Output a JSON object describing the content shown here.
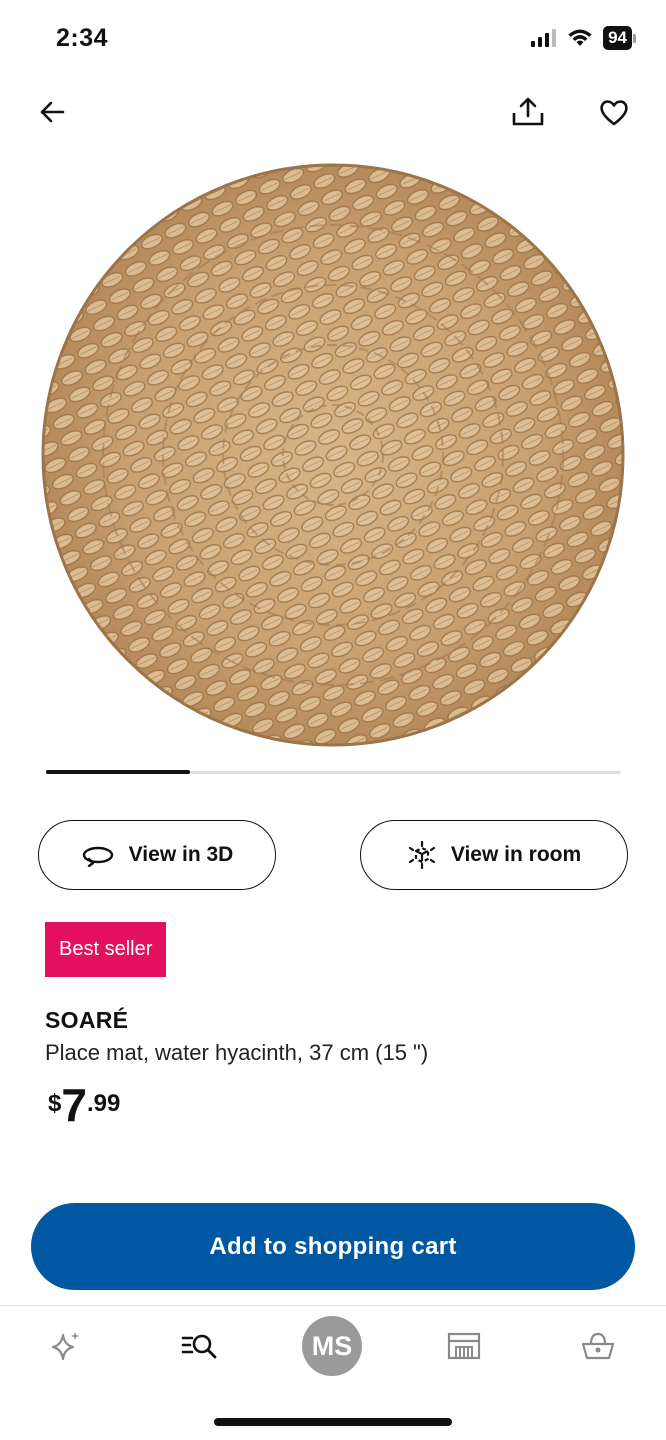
{
  "status_bar": {
    "time": "2:34",
    "battery": "94"
  },
  "nav": {
    "back_icon": "arrow-left-icon",
    "share_icon": "share-icon",
    "favorite_icon": "heart-icon"
  },
  "product_image": {
    "subject": "round woven water hyacinth place mat",
    "colors": {
      "base": "#c9a070",
      "light": "#e2c39a",
      "shadow": "#9b7449"
    }
  },
  "carousel": {
    "position_fraction": 0.25
  },
  "actions": {
    "view_3d_label": "View in 3D",
    "view_3d_icon": "rotate-3d-icon",
    "view_room_label": "View in room",
    "view_room_icon": "ar-cube-icon"
  },
  "product": {
    "badge": "Best seller",
    "badge_color": "#e3105e",
    "name": "SOARÉ",
    "description": "Place mat, water hyacinth, 37 cm (15 \")",
    "price_currency": "$",
    "price_int": "7",
    "price_dec": ".99"
  },
  "cta": {
    "label": "Add to shopping cart",
    "color": "#0058a3"
  },
  "tab_bar": {
    "inspire_icon": "sparkle-icon",
    "search_icon": "search-list-icon",
    "profile_initials": "MS",
    "store_icon": "store-icon",
    "cart_icon": "basket-icon"
  }
}
